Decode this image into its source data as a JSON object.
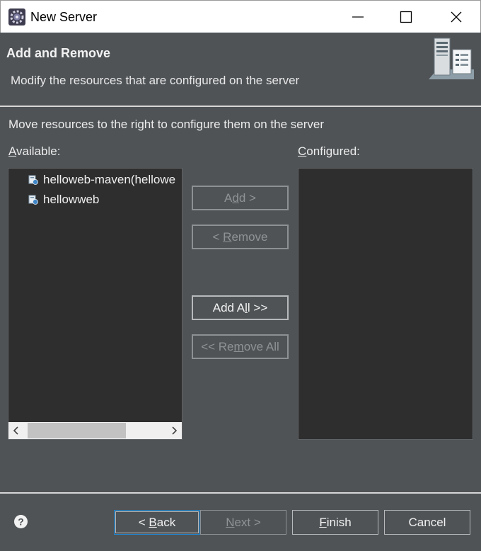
{
  "window": {
    "title": "New Server",
    "icon": "eclipse-gear-icon",
    "controls": {
      "minimize": "minimize-icon",
      "maximize": "maximize-icon",
      "close": "close-icon"
    }
  },
  "header": {
    "title": "Add and Remove",
    "description": "Modify the resources that are configured on the server",
    "icon": "server-icon"
  },
  "body": {
    "instruction": "Move resources to the right to configure them on the server",
    "available": {
      "label_mnemonic": "A",
      "label_rest": "vailable:",
      "items": [
        {
          "label": "helloweb-maven(hellowe",
          "icon": "web-project-icon"
        },
        {
          "label": "hellowweb",
          "icon": "web-project-icon"
        }
      ]
    },
    "configured": {
      "label_mnemonic": "C",
      "label_rest": "onfigured:",
      "items": []
    },
    "buttons": {
      "add": {
        "pre": "A",
        "mn": "d",
        "post": "d >",
        "enabled": false
      },
      "remove": {
        "pre": "< ",
        "mn": "R",
        "post": "emove",
        "enabled": false
      },
      "add_all": {
        "pre": "Add A",
        "mn": "l",
        "post": "l >>",
        "enabled": true
      },
      "remove_all": {
        "pre": "<< Re",
        "mn": "m",
        "post": "ove All",
        "enabled": false
      }
    }
  },
  "footer": {
    "help": "help-icon",
    "back": {
      "pre": "< ",
      "mn": "B",
      "post": "ack",
      "enabled": true
    },
    "next": {
      "pre": "",
      "mn": "N",
      "post": "ext >",
      "enabled": false
    },
    "finish": {
      "pre": "",
      "mn": "F",
      "post": "inish",
      "enabled": true
    },
    "cancel": {
      "label": "Cancel",
      "enabled": true
    }
  },
  "colors": {
    "dialog_bg": "#4f5356",
    "list_bg": "#2e2e2e",
    "text": "#f2f2f2",
    "disabled_text": "#8f9396",
    "focus_border": "#1d87d4"
  }
}
